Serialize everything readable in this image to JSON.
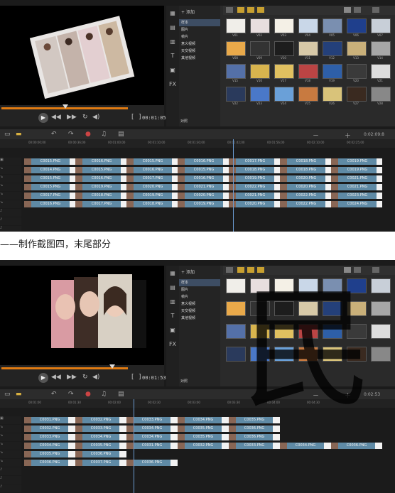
{
  "caption": "——制作截图四，末尾部分",
  "watermark": "民",
  "shot1": {
    "timecode": "00:01:05:1",
    "timeline_time": "0:02:09:8",
    "library": {
      "add_label": "添加",
      "folders": [
        "样本",
        "图片",
        "帧片",
        "意义视频",
        "天交视频",
        "其他视频"
      ],
      "options_label": "对照"
    },
    "thumb_labels": [
      "V01",
      "V02",
      "V03",
      "V04",
      "V05",
      "V06",
      "V07",
      "V08",
      "V09",
      "V10",
      "V11",
      "V12",
      "V13",
      "V14",
      "V15",
      "V16",
      "V17",
      "V18",
      "V19",
      "V20",
      "V21",
      "V22",
      "V23",
      "V24",
      "V25",
      "V26",
      "V27",
      "V28"
    ],
    "ruler_ticks": [
      "00:00:00;00",
      "00:00:36;00",
      "00:01:00;00",
      "00:01:10;00",
      "00:01:30;00",
      "00:01:42;00",
      "00:01:56;00",
      "00:02:10;00",
      "00:02:25;00"
    ],
    "tracks": [
      [
        "C0015.PNG",
        "C0016.PNG",
        "C0015.PNG",
        "C0016.PNG",
        "C0017.PNG",
        "C0018.PNG",
        "C0019.PNG"
      ],
      [
        "C0014.PNG",
        "C0015.PNG",
        "C0016.PNG",
        "C0015.PNG",
        "C0018.PNG",
        "C0018.PNG",
        "C0019.PNG"
      ],
      [
        "C0015.PNG",
        "C0016.PNG",
        "C0017.PNG",
        "C0016.PNG",
        "C0019.PNG",
        "C0020.PNG",
        "C0021.PNG"
      ],
      [
        "C0015.PNG",
        "C0019.PNG",
        "C0020.PNG",
        "C0021.PNG",
        "C0022.PNG",
        "C0020.PNG",
        "C0021.PNG"
      ],
      [
        "C0017.PNG",
        "C0018.PNG",
        "C0019.PNG",
        "C0020.PNG",
        "C0021.PNG",
        "C0022.PNG",
        "C0023.PNG"
      ],
      [
        "C0016.PNG",
        "C0017.PNG",
        "C0018.PNG",
        "C0019.PNG",
        "C0020.PNG",
        "C0022.PNG",
        "C0024.PNG"
      ]
    ]
  },
  "shot2": {
    "timecode": "00:01:53",
    "timeline_time": "0:02:53",
    "library": {
      "add_label": "添加",
      "folders": [
        "样本",
        "图片",
        "帧片",
        "意义视频",
        "天交视频",
        "其他视频"
      ],
      "options_label": "对照"
    },
    "ruler_ticks": [
      "00:01:00",
      "00:01:30",
      "00:02:00",
      "00:02:30",
      "00:03:00",
      "00:03:30",
      "00:04:00",
      "00:04:30"
    ],
    "tracks": [
      [
        "C0031.PNG",
        "C0032.PNG",
        "C0033.PNG",
        "C0034.PNG",
        "C0035.PNG"
      ],
      [
        "C0032.PNG",
        "C0033.PNG",
        "C0034.PNG",
        "C0035.PNG",
        "C0036.PNG"
      ],
      [
        "C0033.PNG",
        "C0034.PNG",
        "C0034.PNG",
        "C0035.PNG",
        "C0036.PNG"
      ],
      [
        "C0034.PNG",
        "C0035.PNG",
        "C0031.PNG",
        "C0032.PNG",
        "C0033.PNG",
        "C0034.PNG",
        "C0036.PNG"
      ],
      [
        "C0035.PNG",
        "C0036.PNG"
      ],
      [
        "C0036.PNG",
        "C0037.PNG",
        "C0036.PNG"
      ]
    ]
  }
}
